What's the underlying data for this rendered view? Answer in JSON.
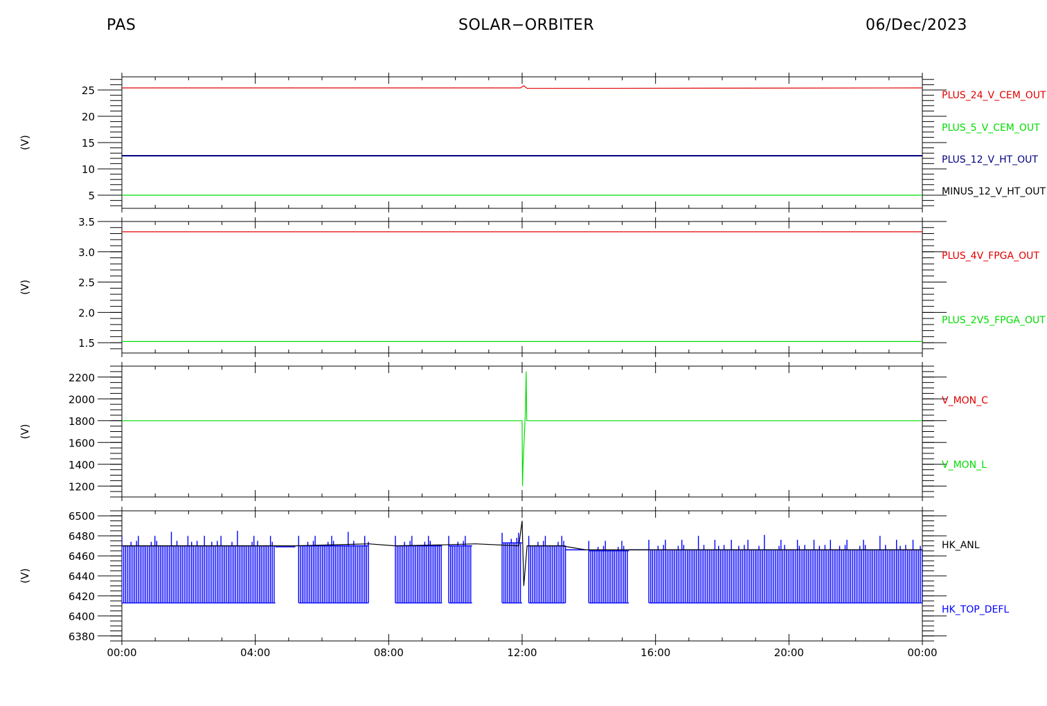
{
  "header": {
    "left": "PAS",
    "center": "SOLAR−ORBITER",
    "right": "06/Dec/2023"
  },
  "colors": {
    "red": "#e00000",
    "green": "#00dd00",
    "navy": "#000080",
    "blue": "#0000ff",
    "black": "#000000"
  },
  "chart_data": [
    {
      "type": "line",
      "ylabel": "(V)",
      "ylim": [
        2.5,
        27.5
      ],
      "y_major": [
        5,
        10,
        15,
        20,
        25
      ],
      "y_minor_step": 1,
      "xlim": [
        "00:00",
        "24:00"
      ],
      "x_ticks": [
        "00:00",
        "04:00",
        "08:00",
        "12:00",
        "16:00",
        "20:00",
        "00:00"
      ],
      "x_tick_hours": [
        0,
        4,
        8,
        12,
        16,
        20,
        24
      ],
      "legend": [
        {
          "name": "PLUS_24_V_CEM_OUT",
          "color": "#e00000"
        },
        {
          "name": "PLUS_5_V_CEM_OUT",
          "color": "#00dd00"
        },
        {
          "name": "PLUS_12_V_HT_OUT",
          "color": "#000080"
        },
        {
          "name": "MINUS_12_V_HT_OUT",
          "color": "#000000"
        }
      ],
      "series": [
        {
          "name": "PLUS_24_V_CEM_OUT",
          "color": "#e00000",
          "x": [
            0,
            11.95,
            12.05,
            12.15,
            24
          ],
          "y": [
            25.4,
            25.4,
            25.8,
            25.3,
            25.4
          ]
        },
        {
          "name": "PLUS_12_V_HT_OUT",
          "color": "#000080",
          "x": [
            0,
            24
          ],
          "y": [
            12.5,
            12.5
          ]
        },
        {
          "name": "PLUS_5_V_CEM_OUT",
          "color": "#00dd00",
          "x": [
            0,
            24
          ],
          "y": [
            5.0,
            5.0
          ]
        }
      ]
    },
    {
      "type": "line",
      "ylabel": "(V)",
      "ylim": [
        1.33,
        3.5
      ],
      "y_major": [
        1.5,
        2.0,
        2.5,
        3.0,
        3.5
      ],
      "y_major_labels": [
        "1.5",
        "2.0",
        "2.5",
        "3.0",
        "3.5"
      ],
      "y_minor_step": 0.1,
      "xlim": [
        "00:00",
        "24:00"
      ],
      "x_ticks": [
        "00:00",
        "04:00",
        "08:00",
        "12:00",
        "16:00",
        "20:00",
        "00:00"
      ],
      "x_tick_hours": [
        0,
        4,
        8,
        12,
        16,
        20,
        24
      ],
      "legend": [
        {
          "name": "PLUS_4V_FPGA_OUT",
          "color": "#e00000"
        },
        {
          "name": "PLUS_2V5_FPGA_OUT",
          "color": "#00dd00"
        }
      ],
      "series": [
        {
          "name": "PLUS_4V_FPGA_OUT",
          "color": "#e00000",
          "x": [
            0,
            24
          ],
          "y": [
            3.33,
            3.33
          ]
        },
        {
          "name": "PLUS_2V5_FPGA_OUT",
          "color": "#00dd00",
          "x": [
            0,
            24
          ],
          "y": [
            1.52,
            1.52
          ]
        }
      ]
    },
    {
      "type": "line",
      "ylabel": "(V)",
      "ylim": [
        1100,
        2300
      ],
      "y_major": [
        1200,
        1400,
        1600,
        1800,
        2000,
        2200
      ],
      "y_minor_step": 50,
      "xlim": [
        "00:00",
        "24:00"
      ],
      "x_ticks": [
        "00:00",
        "04:00",
        "08:00",
        "12:00",
        "16:00",
        "20:00",
        "00:00"
      ],
      "x_tick_hours": [
        0,
        4,
        8,
        12,
        16,
        20,
        24
      ],
      "legend": [
        {
          "name": "V_MON_C",
          "color": "#e00000"
        },
        {
          "name": "V_MON_L",
          "color": "#00dd00"
        }
      ],
      "series": [
        {
          "name": "V_MON_L",
          "color": "#00dd00",
          "x": [
            0,
            12.0,
            12.01,
            12.03,
            12.05,
            12.08,
            12.1,
            12.12,
            12.14,
            12.16,
            12.2,
            24
          ],
          "y": [
            1800,
            1800,
            1200,
            1400,
            1550,
            1750,
            1900,
            2250,
            1800,
            1800,
            1800,
            1800
          ]
        }
      ]
    },
    {
      "type": "line",
      "ylabel": "(V)",
      "ylim": [
        6375,
        6505
      ],
      "y_major": [
        6380,
        6400,
        6420,
        6440,
        6460,
        6480,
        6500
      ],
      "y_minor_step": 5,
      "xlim": [
        "00:00",
        "24:00"
      ],
      "x_ticks": [
        "00:00",
        "04:00",
        "08:00",
        "12:00",
        "16:00",
        "20:00",
        "00:00"
      ],
      "x_tick_hours": [
        0,
        4,
        8,
        12,
        16,
        20,
        24
      ],
      "legend": [
        {
          "name": "HK_ANL",
          "color": "#000000"
        },
        {
          "name": "HK_TOP_DEFL",
          "color": "#0000ff"
        }
      ],
      "series": [
        {
          "name": "HK_ANL",
          "color": "#000000",
          "x": [
            0,
            4.6,
            5.2,
            7.4,
            8.2,
            9.6,
            10.6,
            11.9,
            12.0,
            12.05,
            12.15,
            13.2,
            13.9,
            15.2,
            15.8,
            24
          ],
          "y": [
            6470,
            6470,
            6470,
            6472,
            6470,
            6471,
            6472,
            6470,
            6495,
            6430,
            6470,
            6470,
            6466,
            6466,
            6466,
            6466
          ]
        }
      ],
      "top_defl_bursts": [
        {
          "start": 0.0,
          "end": 4.6,
          "high": 6470,
          "low": 6413
        },
        {
          "start": 5.3,
          "end": 7.4,
          "high": 6470,
          "low": 6413
        },
        {
          "start": 8.2,
          "end": 9.6,
          "high": 6470,
          "low": 6413
        },
        {
          "start": 9.8,
          "end": 10.5,
          "high": 6470,
          "low": 6413
        },
        {
          "start": 11.4,
          "end": 12.0,
          "high": 6473,
          "low": 6413
        },
        {
          "start": 12.2,
          "end": 13.3,
          "high": 6470,
          "low": 6413
        },
        {
          "start": 14.0,
          "end": 15.2,
          "high": 6465,
          "low": 6413
        },
        {
          "start": 15.8,
          "end": 24.0,
          "high": 6466,
          "low": 6413
        }
      ],
      "top_defl_steady": [
        {
          "start": 4.6,
          "end": 5.2,
          "value": 6469
        },
        {
          "start": 13.3,
          "end": 13.9,
          "value": 6466
        },
        {
          "start": 15.2,
          "end": 15.8,
          "value": 6466
        }
      ]
    }
  ]
}
